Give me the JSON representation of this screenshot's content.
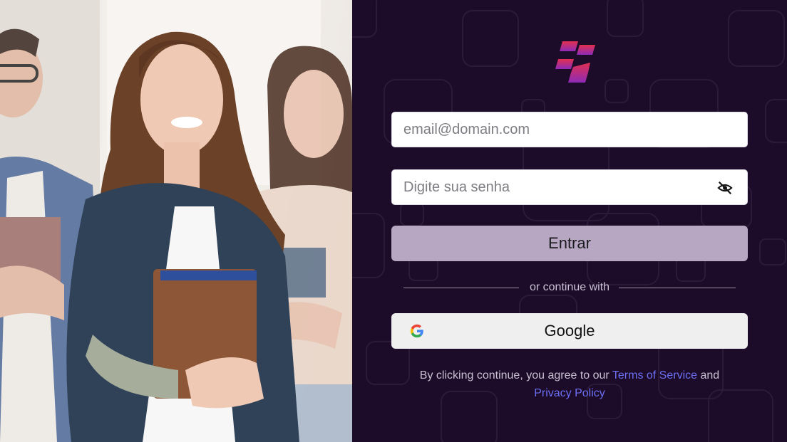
{
  "form": {
    "email_placeholder": "email@domain.com",
    "password_placeholder": "Digite sua senha",
    "submit_label": "Entrar"
  },
  "divider": {
    "text": "or continue with"
  },
  "social": {
    "google_label": "Google"
  },
  "terms": {
    "prefix": "By clicking continue, you agree to our",
    "terms_link": "Terms of Service",
    "conjunction": "and",
    "privacy_link": "Privacy Policy"
  },
  "icons": {
    "logo": "brand-logo-icon",
    "password_toggle": "eye-off-icon",
    "google": "google-g-icon"
  },
  "colors": {
    "panel_background": "#1d0b2a",
    "button_primary": "#b7a7c2",
    "link": "#6b6ff2",
    "logo_top": "#e0304f",
    "logo_bottom": "#8e2bb8"
  }
}
